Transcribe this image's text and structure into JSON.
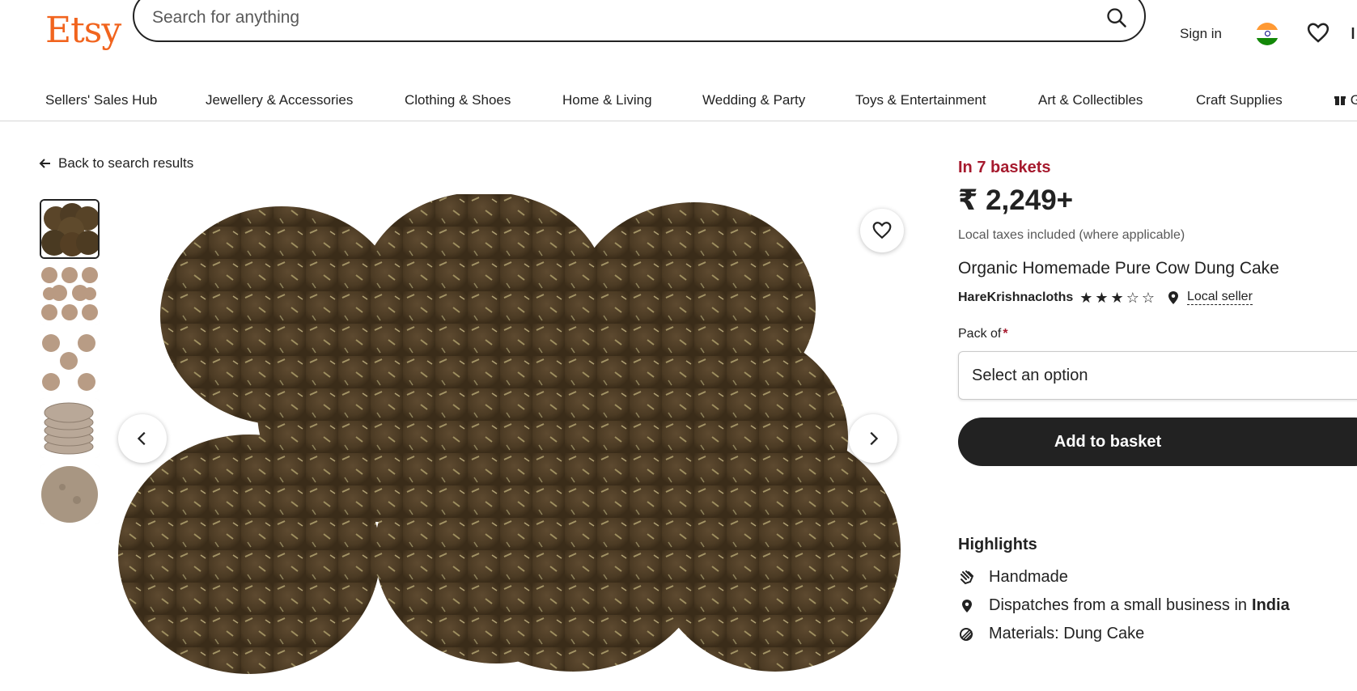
{
  "header": {
    "logo": "Etsy",
    "search_placeholder": "Search for anything",
    "sign_in": "Sign in"
  },
  "categories": [
    "Sellers' Sales Hub",
    "Jewellery & Accessories",
    "Clothing & Shoes",
    "Home & Living",
    "Wedding & Party",
    "Toys & Entertainment",
    "Art & Collectibles",
    "Craft Supplies"
  ],
  "gift_partial": "G",
  "back_link": "Back to search results",
  "product": {
    "baskets": "In 7 baskets",
    "price": "₹ 2,249+",
    "tax_note": "Local taxes included (where applicable)",
    "title": "Organic Homemade Pure Cow Dung Cake",
    "seller": "HareKrishnacloths",
    "rating": 3,
    "max_rating": 5,
    "local_seller": "Local seller",
    "pack_label": "Pack of",
    "required_mark": "*",
    "select_placeholder": "Select an option",
    "add_to_basket": "Add to basket"
  },
  "highlights": {
    "heading": "Highlights",
    "handmade": "Handmade",
    "dispatch_prefix": "Dispatches from a small business in",
    "dispatch_country": "India",
    "materials": "Materials: Dung Cake"
  },
  "colors": {
    "brand": "#F1641E",
    "baskets": "#A61A2E",
    "button": "#222222"
  }
}
